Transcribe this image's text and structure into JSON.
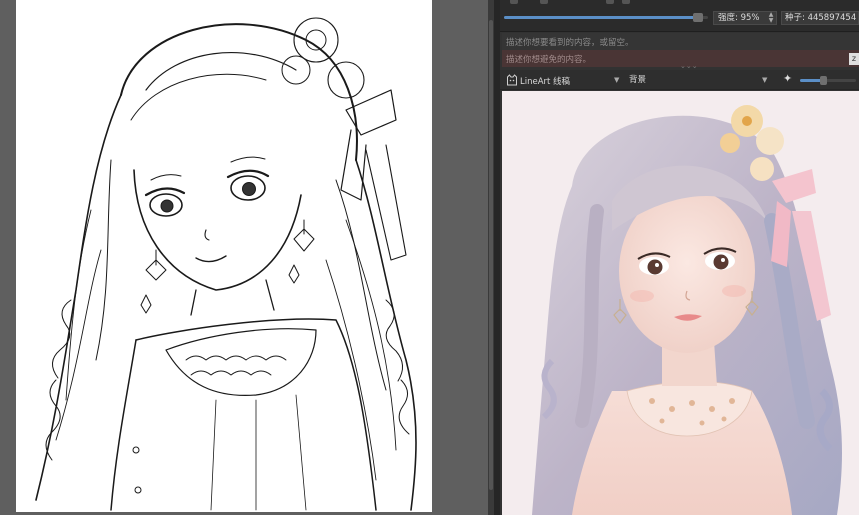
{
  "controls": {
    "strength_label": "强度: 95%",
    "seed_label": "种子: 445897454",
    "strength_percent": 95
  },
  "prompts": {
    "positive_placeholder": "描述你想要看到的内容，或留空。",
    "negative_placeholder": "描述你想避免的内容。",
    "badge": "z"
  },
  "control_layer": {
    "model": "LineArt 线稿",
    "mode": "背景"
  },
  "icons": {
    "model": "cat-icon",
    "generate": "sparkle-icon",
    "dropdown": "chevron-down-icon"
  },
  "colors": {
    "panel_bg": "#323232",
    "accent": "#5b8fc7",
    "negative_bg": "#4a3535"
  }
}
